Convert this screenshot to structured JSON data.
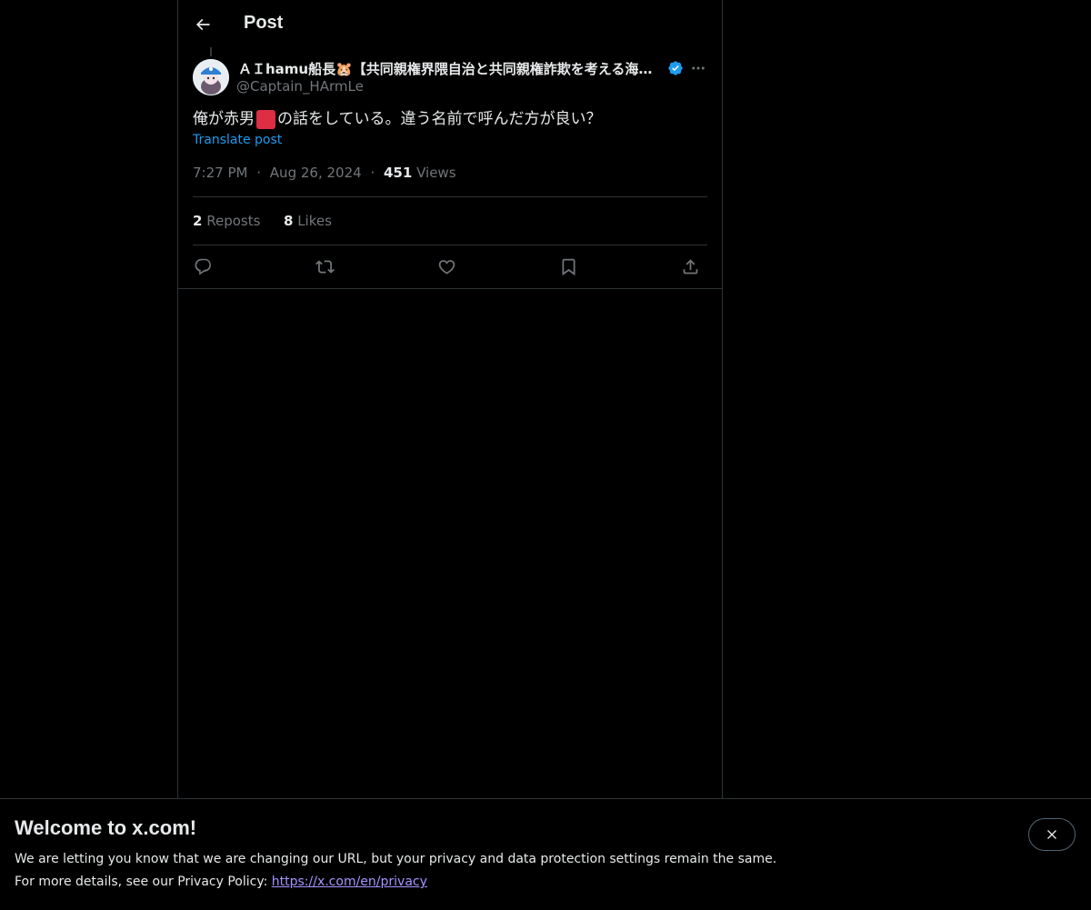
{
  "header": {
    "title": "Post",
    "back_icon": "arrow-left-icon"
  },
  "post": {
    "author": {
      "display_name": "ＡＩhamu船長🐹【共同親権界隈自治と共同親権詐欺を考える海賊☠️",
      "handle": "@Captain_HArmLe",
      "verified": true
    },
    "text_before": "俺が赤男",
    "text_after": "の話をしている。違う名前で呼んだ方が良い？",
    "translate_label": "Translate post",
    "time": "7:27 PM",
    "date": "Aug 26, 2024",
    "separator": "·",
    "views_count": "451",
    "views_label": "Views",
    "reposts_count": "2",
    "reposts_label": "Reposts",
    "likes_count": "8",
    "likes_label": "Likes",
    "actions": [
      "reply-icon",
      "repost-icon",
      "like-icon",
      "bookmark-icon",
      "share-icon"
    ]
  },
  "banner": {
    "title": "Welcome to x.com!",
    "line1": "We are letting you know that we are changing our URL, but your privacy and data protection settings remain the same.",
    "line2_prefix": "For more details, see our Privacy Policy:",
    "link": "https://x.com/en/privacy"
  },
  "colors": {
    "background": "#000000",
    "text": "#e7e9ea",
    "secondary_text": "#71767b",
    "accent": "#1d9bf0",
    "link": "#a694ff",
    "divider": "#2f3336"
  }
}
